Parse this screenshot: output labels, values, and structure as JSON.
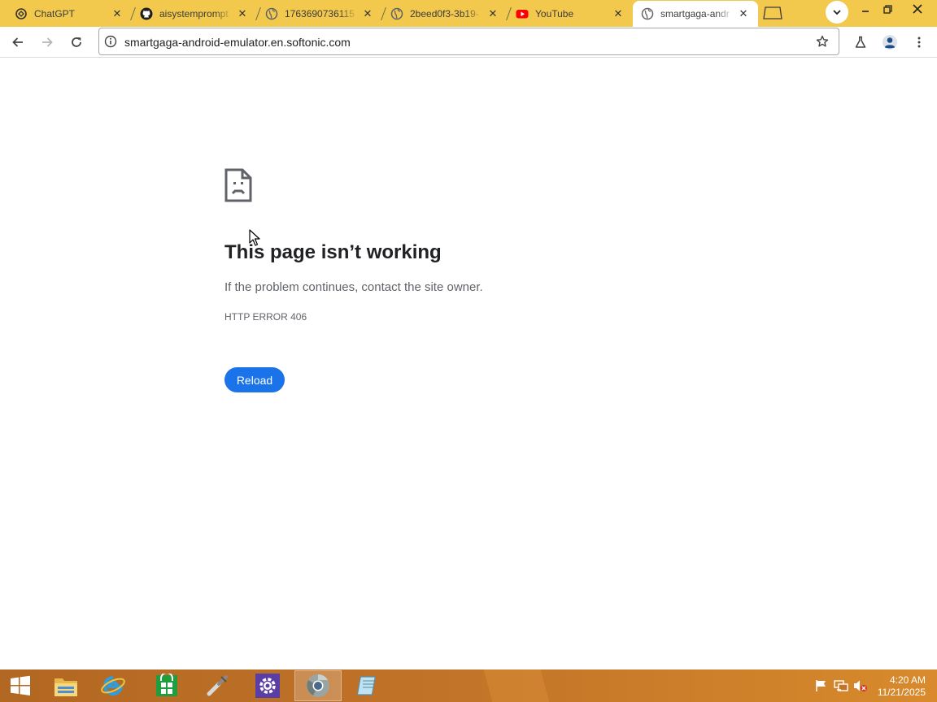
{
  "tabs": [
    {
      "title": "ChatGPT",
      "favicon": "chatgpt-icon",
      "active": false
    },
    {
      "title": "aisystemprompt",
      "favicon": "github-icon",
      "active": false
    },
    {
      "title": "1763690736115",
      "favicon": "globe-icon",
      "active": false
    },
    {
      "title": "2beed0f3-3b19-",
      "favicon": "globe-icon",
      "active": false
    },
    {
      "title": "YouTube",
      "favicon": "youtube-icon",
      "active": false
    },
    {
      "title": "smartgaga-andr",
      "favicon": "globe-icon",
      "active": true
    }
  ],
  "omnibox": {
    "url": "smartgaga-android-emulator.en.softonic.com"
  },
  "error_page": {
    "heading": "This page isn’t working",
    "description": "If the problem continues, contact the site owner.",
    "error_code": "HTTP ERROR 406",
    "reload_label": "Reload"
  },
  "taskbar": {
    "time": "4:20 AM",
    "date": "11/21/2025"
  },
  "colors": {
    "tabstrip": "#f2c94c",
    "accent_blue": "#1a73e8",
    "taskbar": "#c27428"
  }
}
